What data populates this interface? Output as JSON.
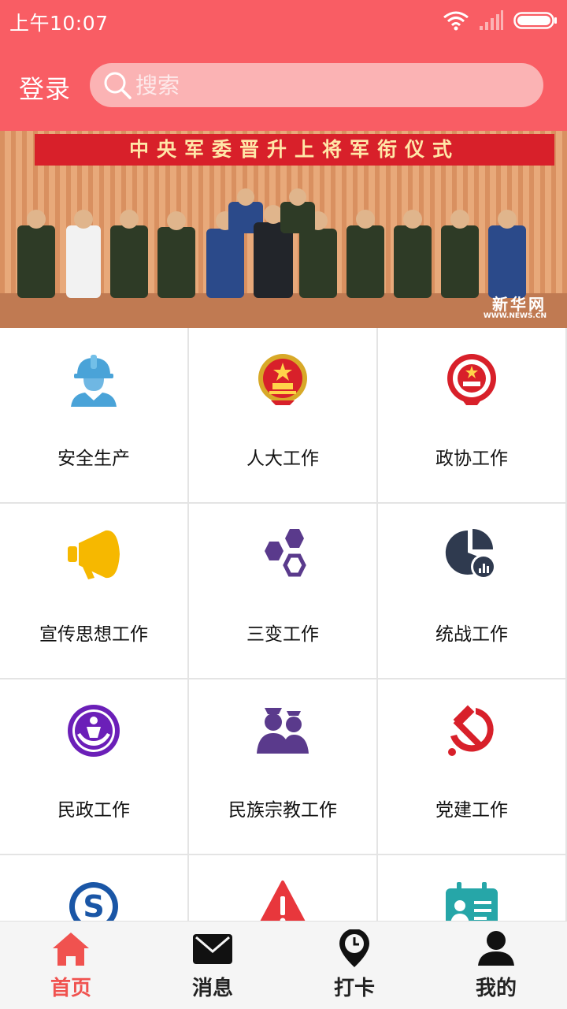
{
  "status_bar": {
    "time": "上午10:07"
  },
  "header": {
    "login_label": "登录",
    "search_placeholder": "搜索"
  },
  "banner": {
    "title": "中央军委晋升上将军衔仪式",
    "watermark": "新华网",
    "watermark_url": "WWW.NEWS.CN"
  },
  "grid": {
    "items": [
      {
        "label": "安全生产",
        "icon": "safety-worker-icon"
      },
      {
        "label": "人大工作",
        "icon": "national-emblem-icon"
      },
      {
        "label": "政协工作",
        "icon": "cppcc-emblem-icon"
      },
      {
        "label": "宣传思想工作",
        "icon": "megaphone-icon"
      },
      {
        "label": "三变工作",
        "icon": "hexagons-icon"
      },
      {
        "label": "统战工作",
        "icon": "pie-chart-icon"
      },
      {
        "label": "民政工作",
        "icon": "civil-affairs-emblem-icon"
      },
      {
        "label": "民族宗教工作",
        "icon": "people-group-icon"
      },
      {
        "label": "党建工作",
        "icon": "hammer-sickle-icon"
      },
      {
        "label": "",
        "icon": "s-logo-icon"
      },
      {
        "label": "",
        "icon": "warning-icon"
      },
      {
        "label": "",
        "icon": "id-card-icon"
      }
    ]
  },
  "nav": {
    "items": [
      {
        "label": "首页",
        "icon": "home-icon",
        "active": true
      },
      {
        "label": "消息",
        "icon": "envelope-icon",
        "active": false
      },
      {
        "label": "打卡",
        "icon": "location-clock-icon",
        "active": false
      },
      {
        "label": "我的",
        "icon": "user-icon",
        "active": false
      }
    ]
  },
  "colors": {
    "header_bg": "#f95d64",
    "search_bg": "#fbb3b4",
    "active_nav": "#f0524f",
    "banner_red": "#d8202a"
  }
}
